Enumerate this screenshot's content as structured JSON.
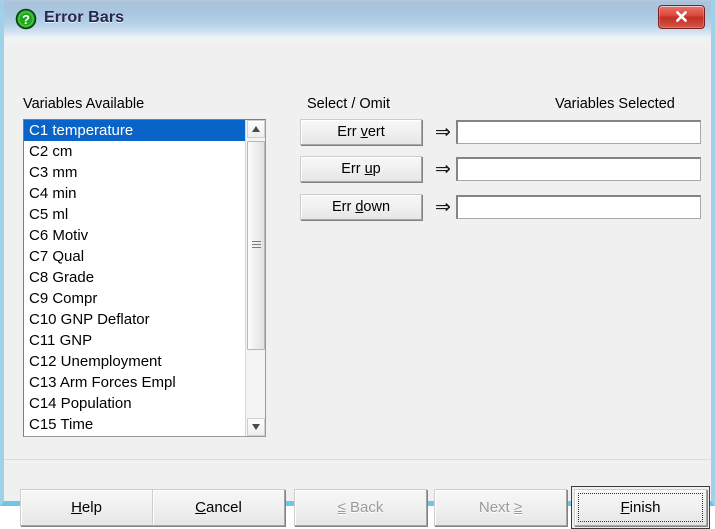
{
  "window": {
    "title": "Error Bars",
    "icon": "question-mark-icon",
    "close_label": "Close",
    "frame_color": "#6ec6e6",
    "titlebar_color": "#a9c7e0"
  },
  "labels": {
    "variables_available": "Variables Available",
    "select_omit": "Select / Omit",
    "variables_selected": "Variables Selected"
  },
  "variables_list": {
    "selected_index": 0,
    "selection_color": "#0a64c8",
    "items": [
      "C1 temperature",
      "C2 cm",
      "C3 mm",
      "C4 min",
      "C5 ml",
      "C6 Motiv",
      "C7 Qual",
      "C8 Grade",
      "C9 Compr",
      "C10 GNP Deflator",
      "C11 GNP",
      "C12 Unemployment",
      "C13 Arm Forces Empl",
      "C14 Population",
      "C15 Time"
    ]
  },
  "select_rows": [
    {
      "button_pre": "Err ",
      "button_mnemonic": "v",
      "button_post": "ert",
      "arrow": "⇒",
      "field_value": "",
      "field_placeholder": ""
    },
    {
      "button_pre": "Err ",
      "button_mnemonic": "u",
      "button_post": "p",
      "arrow": "⇒",
      "field_value": "",
      "field_placeholder": ""
    },
    {
      "button_pre": "Err ",
      "button_mnemonic": "d",
      "button_post": "own",
      "arrow": "⇒",
      "field_value": "",
      "field_placeholder": ""
    }
  ],
  "dialog_buttons": {
    "help": {
      "pre": "",
      "mnemonic": "H",
      "post": "elp",
      "enabled": true
    },
    "cancel": {
      "pre": "",
      "mnemonic": "C",
      "post": "ancel",
      "enabled": true
    },
    "back": {
      "pre": "",
      "mnemonic": "≤",
      "post": " Back",
      "enabled": false
    },
    "next": {
      "pre": "Next ",
      "mnemonic": "≥",
      "post": "",
      "enabled": false
    },
    "finish": {
      "pre": "",
      "mnemonic": "F",
      "post": "inish",
      "enabled": true,
      "is_default": true
    }
  }
}
